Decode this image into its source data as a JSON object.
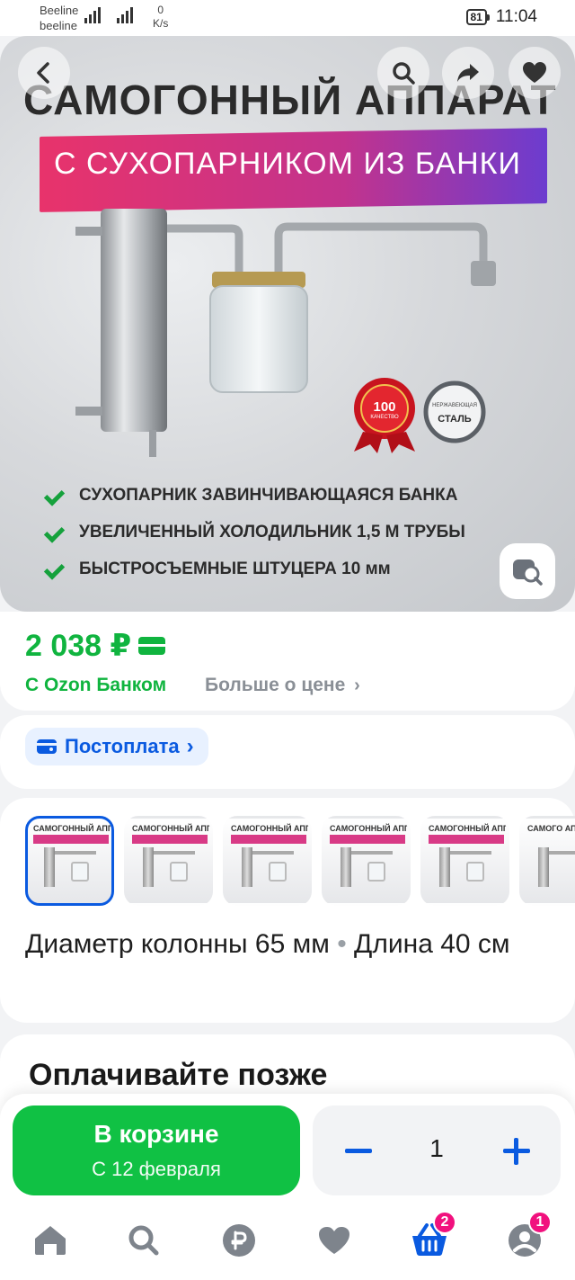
{
  "status_bar": {
    "operator_1": "Beeline",
    "operator_2": "beeline",
    "network": "4G",
    "speed_value": "0",
    "speed_unit": "K/s",
    "battery": "81",
    "time": "11:04"
  },
  "hero": {
    "title": "САМОГОННЫЙ АППАРАТ",
    "subtitle": "С СУХОПАРНИКОМ ИЗ БАНКИ",
    "badge_quality_num": "100",
    "badge_quality_text": "КАЧЕСТВО",
    "badge_steel_top": "НЕРЖАВЕЮЩАЯ",
    "badge_steel_main": "СТАЛЬ",
    "features": [
      "СУХОПАРНИК ЗАВИНЧИВАЮЩАЯСЯ БАНКА",
      "УВЕЛИЧЕННЫЙ ХОЛОДИЛЬНИК 1,5 М ТРУБЫ",
      "БЫСТРОСЪЕМНЫЕ ШТУЦЕРА 10 мм"
    ]
  },
  "price": {
    "value": "2 038 ₽",
    "bank_label": "С Ozon Банком",
    "more_label": "Больше о цене"
  },
  "postpay": {
    "label": "Постоплата"
  },
  "variants": {
    "thumb_caption": "САМОГОННЫЙ АППАРАТ",
    "thumb_caption_last": "САМОГО АППАРАТ",
    "thumb_count": 6,
    "selected_index": 0,
    "spec_diameter": "Диаметр колонны 65 мм",
    "spec_separator": "•",
    "spec_length": "Длина 40 см"
  },
  "pay_later": {
    "title": "Оплачивайте позже"
  },
  "action_bar": {
    "cart_label": "В корзине",
    "delivery_label": "С 12 февраля",
    "quantity": "1"
  },
  "tab_bar": {
    "cart_badge": "2",
    "profile_badge": "1"
  },
  "colors": {
    "accent_green": "#10c144",
    "accent_blue": "#0a5ae0",
    "badge_pink": "#f1117e"
  }
}
